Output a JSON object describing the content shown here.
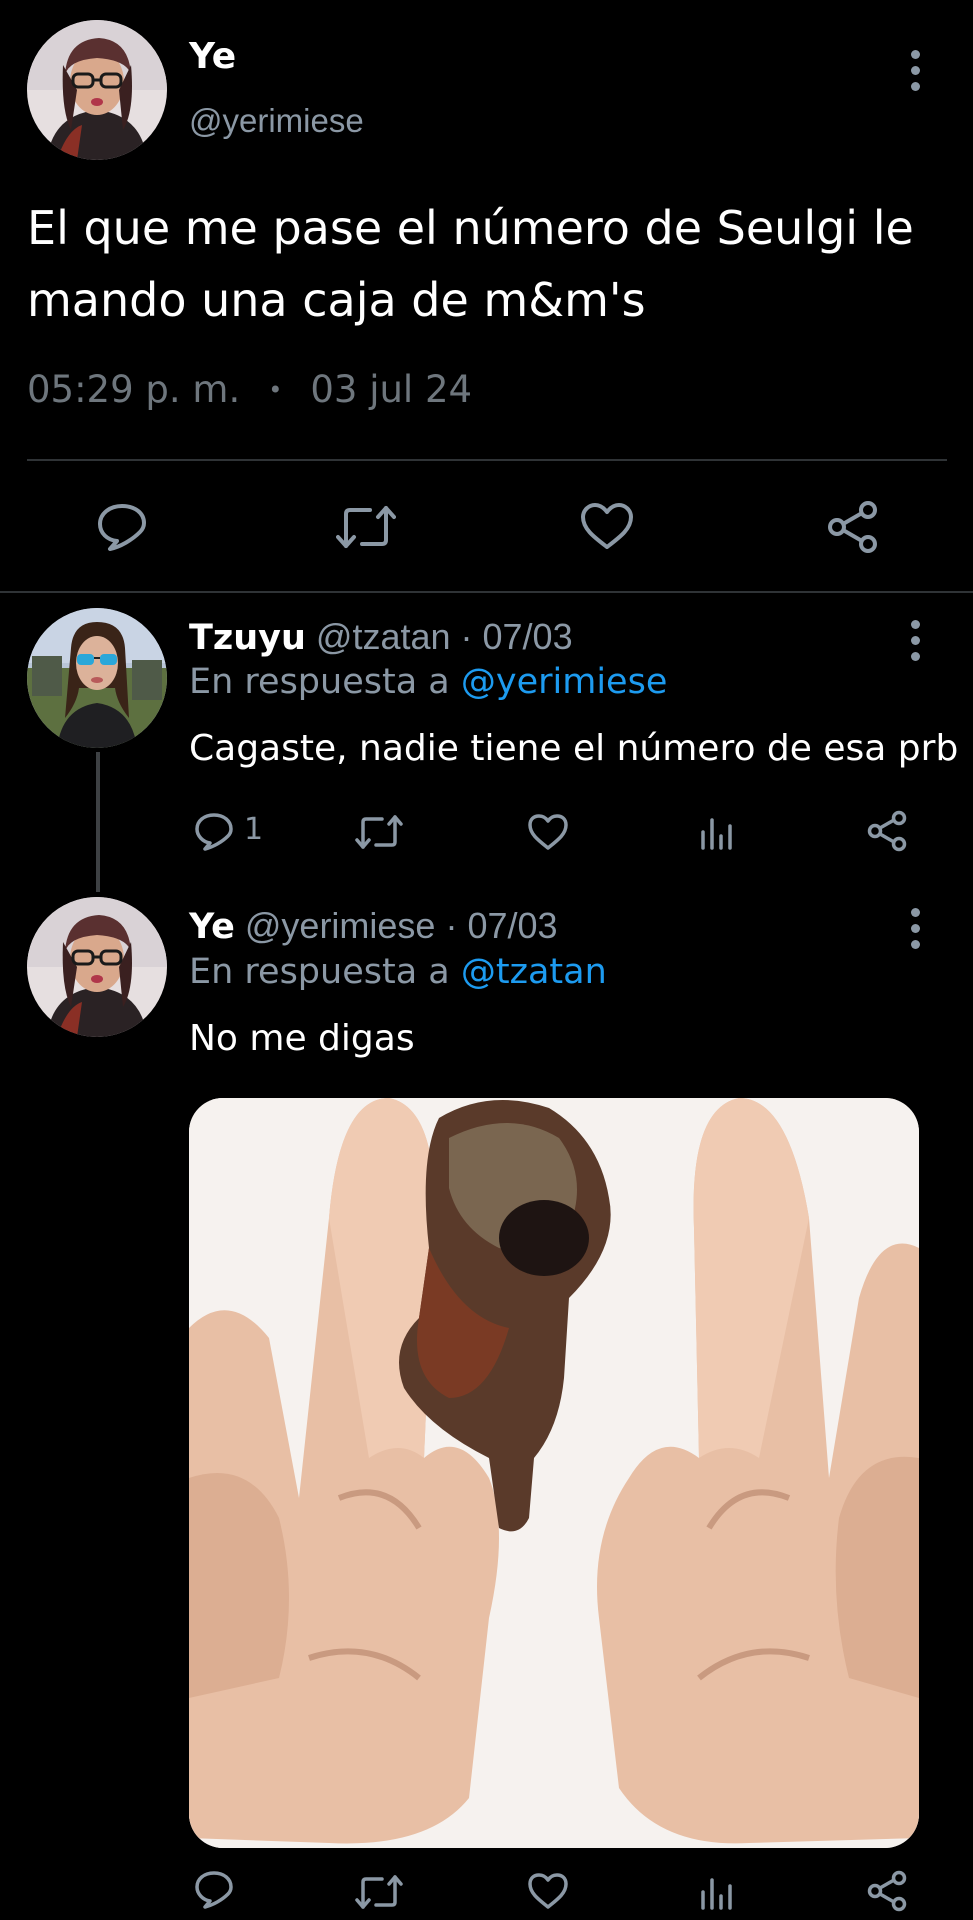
{
  "main_tweet": {
    "author_name": "Ye",
    "handle": "@yerimiese",
    "text": "El que me pase el número de Seulgi le\nmando una caja de m&m's",
    "time": "05:29 p. m.",
    "separator": "•",
    "date": "03 jul 24",
    "actions": [
      "reply-icon",
      "retweet-icon",
      "like-icon",
      "share-icon"
    ]
  },
  "replies": [
    {
      "author_name": "Tzuyu",
      "handle_date": "@tzatan · 07/03",
      "reply_prefix": "En respuesta a",
      "reply_mention": "@yerimiese",
      "text": "Cagaste, nadie tiene el número de esa prb",
      "reply_count": "1",
      "actions": [
        "reply-icon",
        "retweet-icon",
        "like-icon",
        "views-icon",
        "share-icon"
      ]
    },
    {
      "author_name": "Ye",
      "handle_date": "@yerimiese · 07/03",
      "reply_prefix": "En respuesta a",
      "reply_mention": "@tzatan",
      "text": "No me digas",
      "media": "gif-image",
      "actions": [
        "reply-icon",
        "retweet-icon",
        "like-icon",
        "views-icon",
        "share-icon"
      ]
    }
  ],
  "colors": {
    "background": "#000000",
    "text": "#ffffff",
    "secondary": "#8b98a5",
    "link": "#1d9bf0",
    "divider": "#2f3336"
  }
}
